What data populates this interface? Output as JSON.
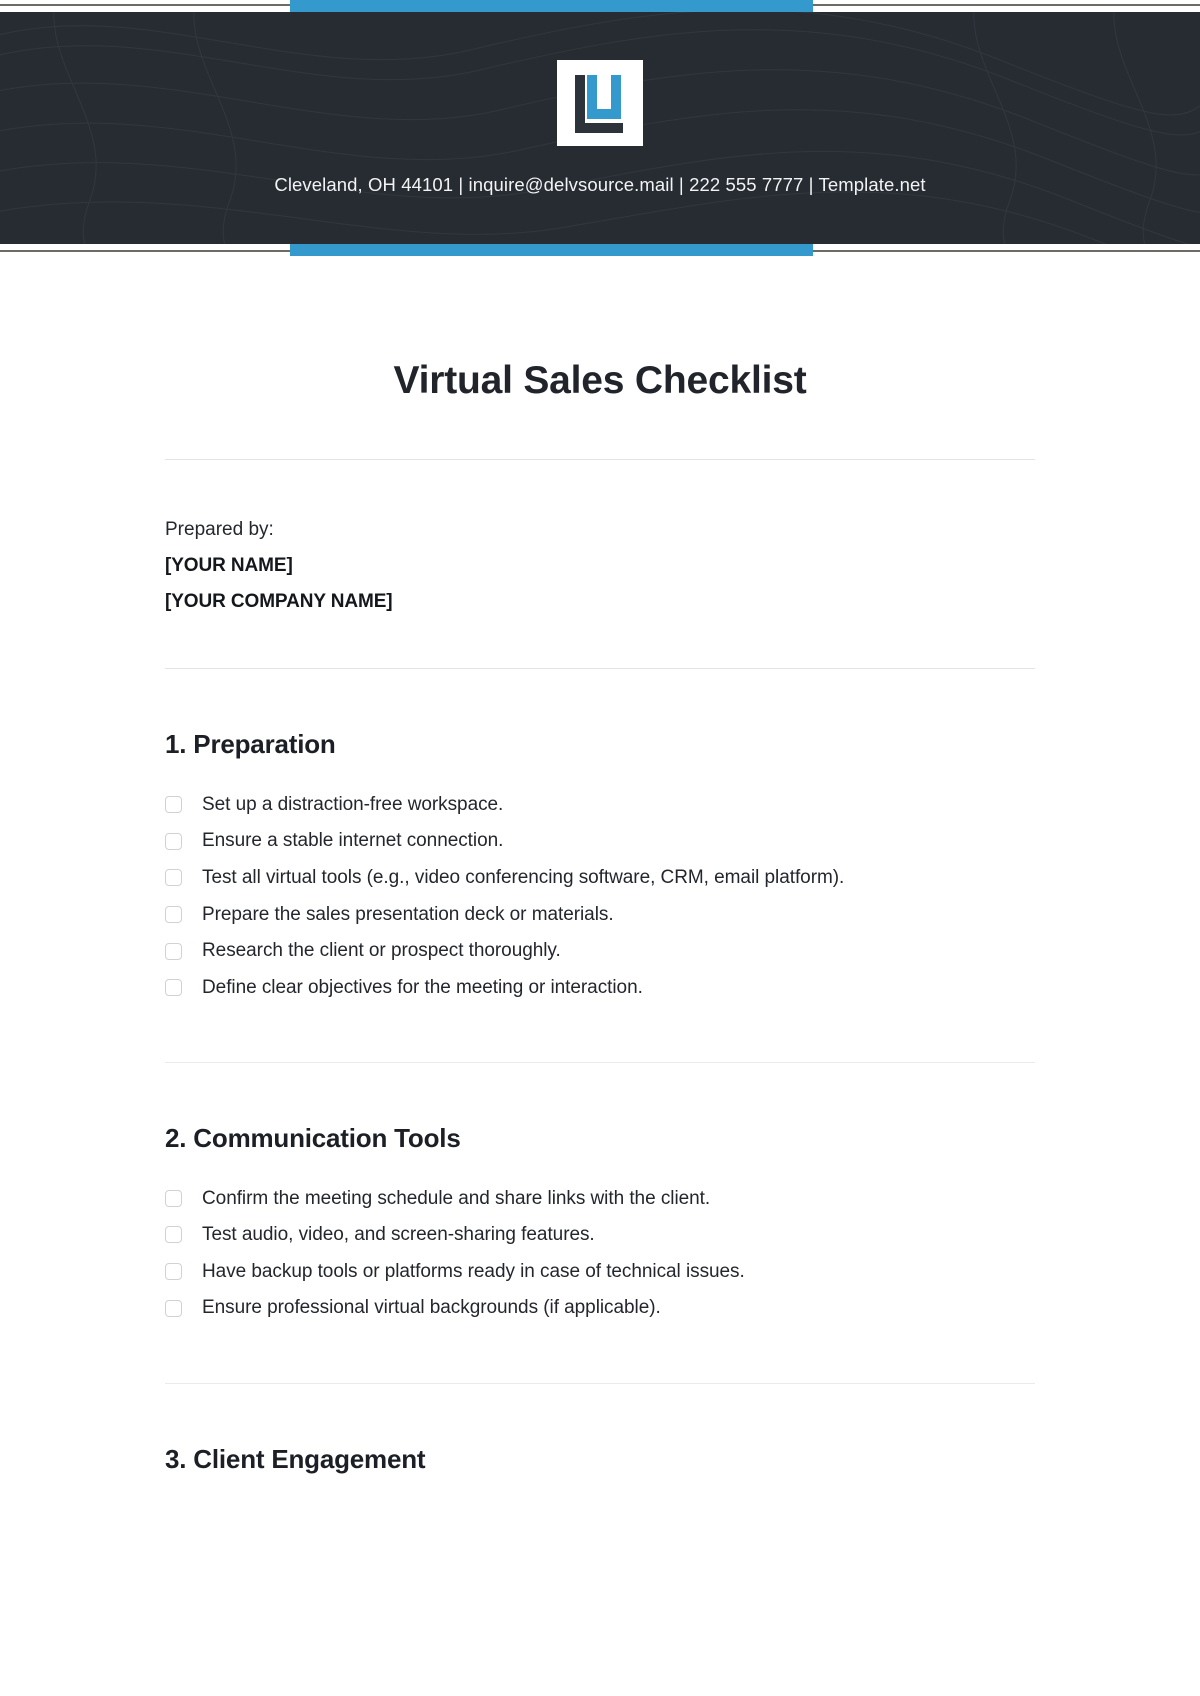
{
  "header": {
    "logo_alt": "DelvSource logo",
    "contact_line": "Cleveland, OH 44101  |  inquire@delvsource.mail  |  222 555 7777  |  Template.net",
    "accent_color": "#3499cc",
    "background_color": "#272c33"
  },
  "document": {
    "title": "Virtual Sales Checklist",
    "prepared_by_label": "Prepared by:",
    "prepared_by_name": "[YOUR NAME]",
    "prepared_by_company": "[YOUR COMPANY NAME]"
  },
  "sections": [
    {
      "heading": "1. Preparation",
      "items": [
        "Set up a distraction-free workspace.",
        "Ensure a stable internet connection.",
        "Test all virtual tools (e.g., video conferencing software, CRM, email platform).",
        "Prepare the sales presentation deck or materials.",
        "Research the client or prospect thoroughly.",
        "Define clear objectives for the meeting or interaction."
      ]
    },
    {
      "heading": "2. Communication Tools",
      "items": [
        "Confirm the meeting schedule and share links with the client.",
        "Test audio, video, and screen-sharing features.",
        "Have backup tools or platforms ready in case of technical issues.",
        "Ensure professional virtual backgrounds (if applicable)."
      ]
    },
    {
      "heading": "3. Client Engagement",
      "items": []
    }
  ]
}
